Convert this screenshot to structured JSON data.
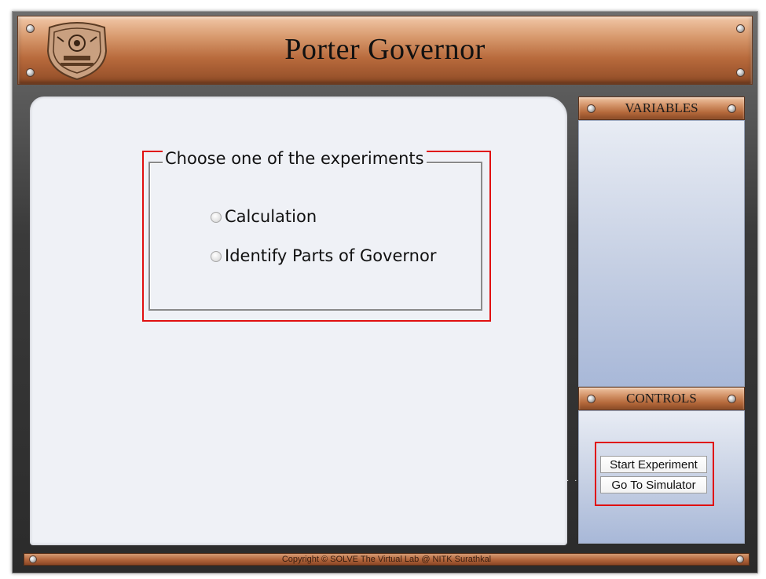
{
  "header": {
    "title": "Porter Governor",
    "logo_icon": "nitk-emblem-icon"
  },
  "experiment_selector": {
    "legend": "Choose one of the experiments",
    "options": [
      {
        "label": "Calculation",
        "selected": false
      },
      {
        "label": "Identify Parts of Governor",
        "selected": false
      }
    ]
  },
  "sidebar": {
    "variables_title": "VARIABLES",
    "controls_title": "CONTROLS",
    "buttons": {
      "start_experiment": "Start Experiment",
      "go_to_simulator": "Go To Simulator"
    }
  },
  "footer": {
    "copyright": "Copyright © SOLVE The Virtual Lab @ NITK Surathkal"
  },
  "colors": {
    "copper_accent": "#b86a3c",
    "highlight_red": "#e01010",
    "panel_blue": "#a8b8d8",
    "content_bg": "#eff1f6"
  }
}
